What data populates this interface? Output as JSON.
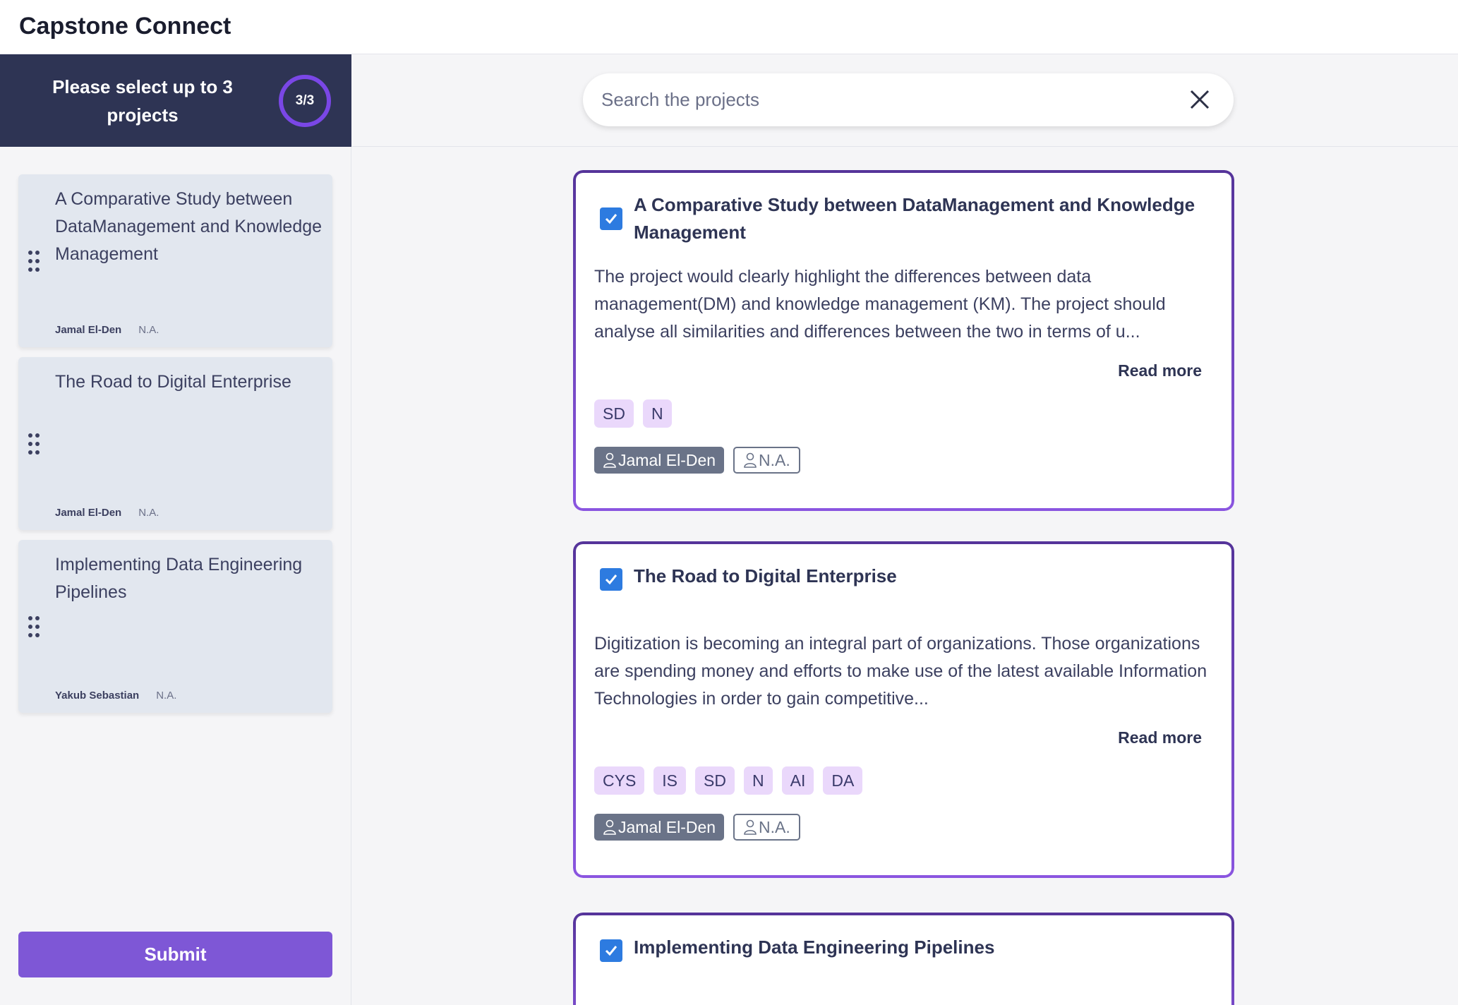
{
  "app": {
    "title": "Capstone Connect"
  },
  "sidebar": {
    "prompt": "Please select up to 3 projects",
    "counter": "3/3",
    "selected": [
      {
        "title": "A Comparative Study between DataManagement and Knowledge Management",
        "supervisor": "Jamal El-Den",
        "co_supervisor": "N.A."
      },
      {
        "title": "The Road to Digital Enterprise",
        "supervisor": "Jamal El-Den",
        "co_supervisor": "N.A."
      },
      {
        "title": "Implementing Data Engineering Pipelines",
        "supervisor": "Yakub Sebastian",
        "co_supervisor": "N.A."
      }
    ],
    "submit_label": "Submit"
  },
  "search": {
    "placeholder": "Search the projects",
    "value": ""
  },
  "projects": [
    {
      "checked": true,
      "title": "A Comparative Study between DataManagement and Knowledge Management",
      "description": "The project would clearly highlight the differences between data management(DM) and knowledge management (KM). The project should analyse all similarities and differences between the two in terms of u...",
      "read_more": "Read more",
      "tags": [
        "SD",
        "N"
      ],
      "supervisor": "Jamal El-Den",
      "co_supervisor": "N.A."
    },
    {
      "checked": true,
      "title": "The Road to Digital Enterprise",
      "description": "Digitization is becoming an integral part of organizations. Those organizations are spending money and efforts to make use of the latest available Information Technologies in order to gain competitive...",
      "read_more": "Read more",
      "tags": [
        "CYS",
        "IS",
        "SD",
        "N",
        "AI",
        "DA"
      ],
      "supervisor": "Jamal El-Den",
      "co_supervisor": "N.A."
    },
    {
      "checked": true,
      "title": "Implementing Data Engineering Pipelines"
    }
  ],
  "colors": {
    "sidebar_header": "#2e3454",
    "accent": "#7e57d6",
    "checkbox": "#2d7be0",
    "tag_bg": "#ead8fb",
    "supervisor_badge": "#6a7388"
  }
}
